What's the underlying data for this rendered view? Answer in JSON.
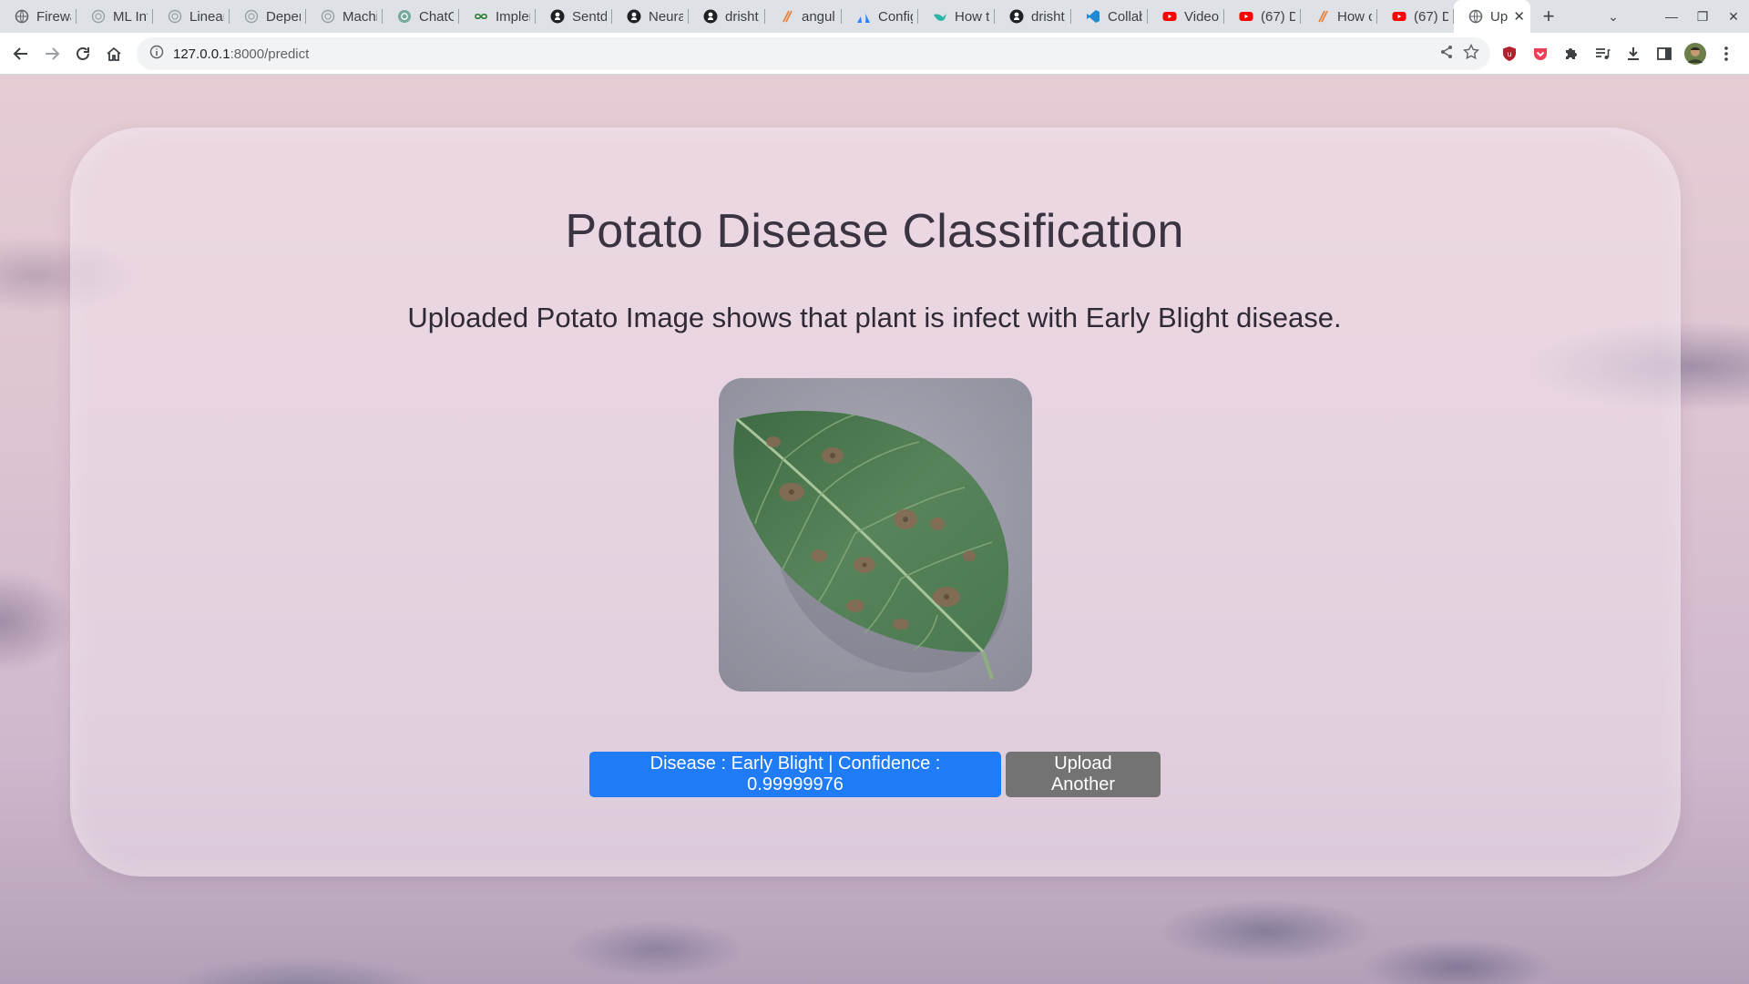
{
  "browser": {
    "tabs": [
      {
        "title": "Firewa",
        "icon": "globe-icon"
      },
      {
        "title": "ML Int",
        "icon": "openai-icon"
      },
      {
        "title": "Linear",
        "icon": "openai-icon"
      },
      {
        "title": "Deper",
        "icon": "openai-icon"
      },
      {
        "title": "Machi",
        "icon": "openai-icon"
      },
      {
        "title": "ChatG",
        "icon": "chatgpt-icon"
      },
      {
        "title": "Impler",
        "icon": "infinity-icon"
      },
      {
        "title": "Sentd",
        "icon": "github-icon"
      },
      {
        "title": "Neura",
        "icon": "github-icon"
      },
      {
        "title": "drisht",
        "icon": "github-icon"
      },
      {
        "title": "angul",
        "icon": "slash-icon"
      },
      {
        "title": "Config",
        "icon": "atlassian-icon"
      },
      {
        "title": "How t",
        "icon": "bird-icon"
      },
      {
        "title": "drisht",
        "icon": "github-icon"
      },
      {
        "title": "Collab",
        "icon": "vscode-icon"
      },
      {
        "title": "Video",
        "icon": "youtube-icon"
      },
      {
        "title": "(67) D",
        "icon": "youtube-icon"
      },
      {
        "title": "How c",
        "icon": "slash-icon"
      },
      {
        "title": "(67) D",
        "icon": "youtube-icon"
      }
    ],
    "active_tab": {
      "title": "Up",
      "icon": "globe-icon"
    },
    "url_host": "127.0.0.1",
    "url_path": ":8000/predict"
  },
  "page": {
    "title": "Potato Disease Classification",
    "subtitle": "Uploaded Potato Image shows that plant is infect with Early Blight disease.",
    "result_button": "Disease : Early Blight | Confidence : 0.99999976",
    "upload_button": "Upload Another"
  },
  "colors": {
    "primary_button": "#1f7cf6",
    "secondary_button": "#737373"
  }
}
